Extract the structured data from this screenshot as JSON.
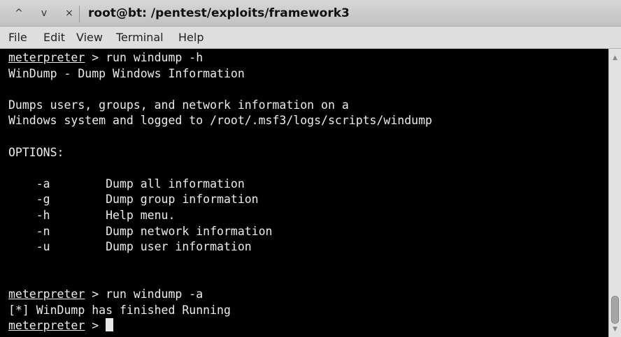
{
  "window": {
    "title": "root@bt: /pentest/exploits/framework3",
    "controls": {
      "up": "^",
      "down": "v",
      "close": "×"
    }
  },
  "menu": [
    "File",
    "Edit",
    "View",
    "Terminal",
    "Help"
  ],
  "terminal": {
    "prompt": "meterpreter",
    "lines": [
      {
        "prompt": "meterpreter",
        "text": " > run windump -h"
      },
      {
        "text": "WinDump - Dump Windows Information"
      },
      {
        "text": ""
      },
      {
        "text": "Dumps users, groups, and network information on a"
      },
      {
        "text": "Windows system and logged to /root/.msf3/logs/scripts/windump"
      },
      {
        "text": ""
      },
      {
        "text": "OPTIONS:"
      },
      {
        "text": ""
      },
      {
        "text": "    -a        Dump all information"
      },
      {
        "text": "    -g        Dump group information"
      },
      {
        "text": "    -h        Help menu."
      },
      {
        "text": "    -n        Dump network information"
      },
      {
        "text": "    -u        Dump user information"
      },
      {
        "text": ""
      },
      {
        "text": ""
      },
      {
        "prompt": "meterpreter",
        "text": " > run windump -a"
      },
      {
        "text": "[*] WinDump has finished Running"
      },
      {
        "prompt": "meterpreter",
        "text": " > ",
        "cursor": true
      }
    ]
  },
  "scrollbar": {
    "up_arrow": "▲",
    "down_arrow": "▼"
  }
}
